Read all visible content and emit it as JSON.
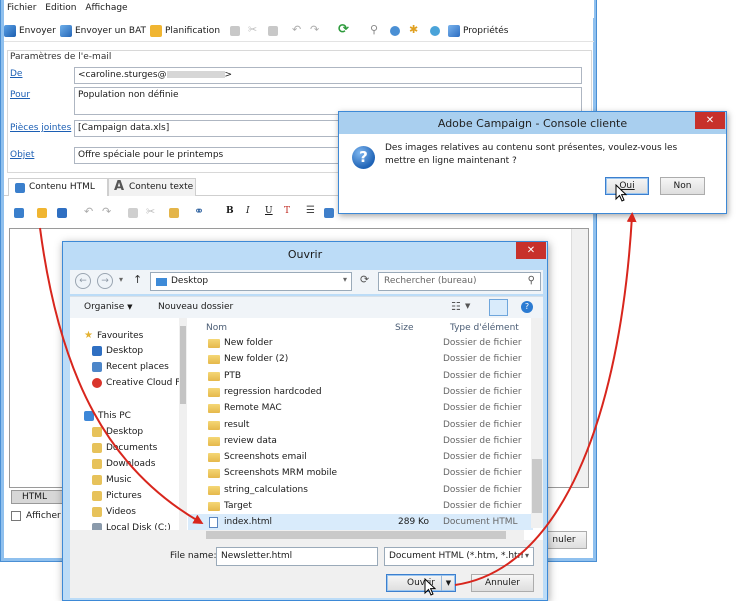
{
  "menu": [
    "Fichier",
    "Edition",
    "Affichage"
  ],
  "toolbar": {
    "send": "Envoyer",
    "send_bat": "Envoyer un BAT",
    "schedule": "Planification",
    "properties": "Propriétés"
  },
  "params": {
    "legend": "Paramètres de l'e-mail",
    "from_label": "De",
    "from_value": "<caroline.sturges@",
    "from_suffix": ">",
    "to_label": "Pour",
    "to_value": "Population non définie",
    "attach_label": "Pièces jointes",
    "attach_value": "[Campaign data.xls]",
    "subject_label": "Objet",
    "subject_value": "Offre spéciale pour le printemps"
  },
  "tabs": {
    "html": "Contenu HTML",
    "text": "Contenu texte"
  },
  "editor": {
    "html_tab": "HTML",
    "show_label": "Afficher",
    "cancel_partial": "nuler"
  },
  "adobe_dialog": {
    "title": "Adobe Campaign - Console cliente",
    "close": "✕",
    "message": "Des images relatives au contenu sont présentes, voulez-vous les mettre en ligne maintenant ?",
    "yes": "Oui",
    "no": "Non"
  },
  "open_dialog": {
    "title": "Ouvrir",
    "close": "✕",
    "address": "Desktop",
    "search_placeholder": "Rechercher (bureau)",
    "organize": "Organise",
    "new_folder": "Nouveau dossier",
    "nav": {
      "favourites": "Favourites",
      "desktop": "Desktop",
      "recent_places": "Recent places",
      "creative_cloud": "Creative Cloud Fi",
      "this_pc": "This PC",
      "pc_desktop": "Desktop",
      "documents": "Documents",
      "downloads": "Downloads",
      "music": "Music",
      "pictures": "Pictures",
      "videos": "Videos",
      "local_disk": "Local Disk (C:)"
    },
    "columns": {
      "name": "Nom",
      "size": "Size",
      "type": "Type d'élément"
    },
    "files": [
      {
        "name": "New folder",
        "size": "",
        "type": "Dossier de fichier"
      },
      {
        "name": "New folder (2)",
        "size": "",
        "type": "Dossier de fichier"
      },
      {
        "name": "PTB",
        "size": "",
        "type": "Dossier de fichier"
      },
      {
        "name": "regression hardcoded",
        "size": "",
        "type": "Dossier de fichier"
      },
      {
        "name": "Remote MAC",
        "size": "",
        "type": "Dossier de fichier"
      },
      {
        "name": "result",
        "size": "",
        "type": "Dossier de fichier"
      },
      {
        "name": "review data",
        "size": "",
        "type": "Dossier de fichier"
      },
      {
        "name": "Screenshots email",
        "size": "",
        "type": "Dossier de fichier"
      },
      {
        "name": "Screenshots MRM mobile",
        "size": "",
        "type": "Dossier de fichier"
      },
      {
        "name": "string_calculations",
        "size": "",
        "type": "Dossier de fichier"
      },
      {
        "name": "Target",
        "size": "",
        "type": "Dossier de fichier"
      },
      {
        "name": "index.html",
        "size": "289 Ko",
        "type": "Document HTML"
      }
    ],
    "filename_label": "File name:",
    "filename_value": "Newsletter.html",
    "filetype_value": "Document HTML (*.htm, *.html",
    "open_button": "Ouvrir",
    "cancel_button": "Annuler"
  },
  "colors": {
    "accent": "#3d89d6",
    "titlebar": "#a9cfef",
    "close": "#c7312b",
    "arrow": "#d8261d",
    "link": "#1c5fb4"
  }
}
